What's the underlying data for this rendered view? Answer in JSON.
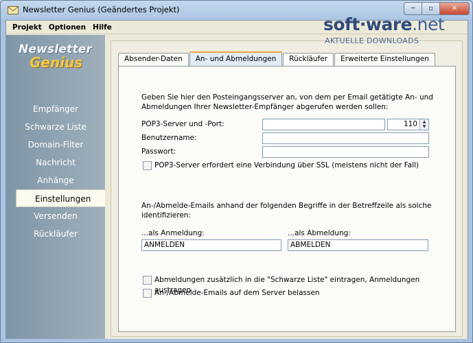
{
  "window": {
    "title": "Newsletter Genius  (Geändertes Projekt)",
    "controls": {
      "minimize": "─",
      "maximize": "▫",
      "close": "✕"
    }
  },
  "menu": {
    "items": [
      "Projekt",
      "Optionen",
      "Hilfe"
    ]
  },
  "logo": {
    "line1": "Newsletter",
    "line2": "Genius"
  },
  "watermark": {
    "main_a": "soft",
    "main_b": "ware",
    "main_c": ".net",
    "sub": "AKTUELLE DOWNLOADS"
  },
  "nav": {
    "items": [
      "Empfänger",
      "Schwarze Liste",
      "Domain-Filter",
      "Nachricht",
      "Anhänge",
      "Einstellungen",
      "Versenden",
      "Rückläufer"
    ],
    "active_index": 5
  },
  "tabs": [
    "Absender-Daten",
    "An- und Abmeldungen",
    "Rückläufer",
    "Erweiterte Einstellungen"
  ],
  "active_tab": 1,
  "pop3": {
    "intro_line1": "Geben Sie hier den Posteingangsserver an, von dem per Email getätigte An- und",
    "intro_line2": "Abmeldungen Ihrer Newsletter-Empfänger abgerufen werden sollen:",
    "server_label": "POP3-Server und -Port:",
    "server_value": "",
    "port_value": "110",
    "user_label": "Benutzername:",
    "user_value": "",
    "password_label": "Passwort:",
    "password_value": "",
    "ssl_label": "POP3-Server erfordert eine Verbindung über SSL (meistens nicht der Fall)",
    "ssl_checked": false
  },
  "keywords": {
    "intro_line1": "An-/Abmelde-Emails anhand der folgenden Begriffe in der Betreffzeile als solche",
    "intro_line2": "identifizieren:",
    "subscribe_label": "...als Anmeldung:",
    "subscribe_value": "ANMELDEN",
    "unsubscribe_label": "...als Abmeldung:",
    "unsubscribe_value": "ABMELDEN"
  },
  "options": {
    "blacklist_label": "Abmeldungen zusätzlich in die \"Schwarze Liste\" eintragen, Anmeldungen austragen",
    "keep_on_server_label": "An-/Abmelde-Emails auf dem Server belassen"
  }
}
